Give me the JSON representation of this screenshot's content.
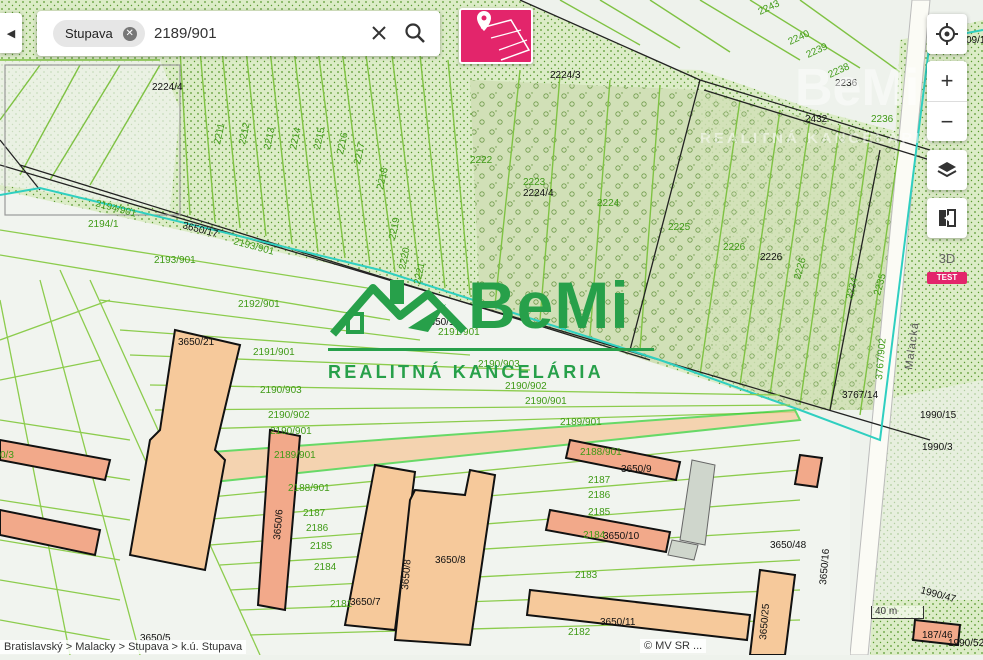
{
  "search": {
    "chip_label": "Stupava",
    "query": "2189/901",
    "placeholder": ""
  },
  "watermark": {
    "brand": "BeMi",
    "subtitle": "REALITNÁ KANCELÁRIA"
  },
  "controls": {
    "zoom_in": "+",
    "zoom_out": "−",
    "three_d": "3D",
    "test_badge": "TEST"
  },
  "map": {
    "street": "Malacká",
    "scale": "40 m",
    "attribution": "© MV SR ...",
    "breadcrumb": "Bratislavský > Malacky > Stupava > k.ú. Stupava",
    "parcels": [
      "2224/4",
      "2211",
      "2212",
      "2213",
      "2214",
      "2215",
      "2216",
      "2217",
      "2218",
      "2219",
      "2220",
      "2221",
      "2224/3",
      "2222",
      "2223",
      "2224/4",
      "2224",
      "2225",
      "2226",
      "2226",
      "2243",
      "2240",
      "2239",
      "2238",
      "2237",
      "2236",
      "2236",
      "2235",
      "2234",
      "2233",
      "2194/901",
      "2194/1",
      "3650/17",
      "2193/901",
      "2192/901",
      "3650/1",
      "2191/901",
      "2191/901",
      "2190/903",
      "2190/903",
      "2190/902",
      "2190/901",
      "2190/902",
      "2190/901",
      "2189/901",
      "2189/901",
      "2188/901",
      "2188/901",
      "2187",
      "2186",
      "2185",
      "2184",
      "2183",
      "2182",
      "2181",
      "2187",
      "2186",
      "2185",
      "2184",
      "3767/14",
      "3767/902",
      "1990/15",
      "1990/3",
      "1990/47",
      "187/46",
      "3650/48",
      "3650/16",
      "3650/25",
      "3650/11",
      "3650/10",
      "3650/9",
      "3650/8",
      "3650/7",
      "3650/6",
      "3650/5",
      "3650/21",
      "3650/4",
      "3650/3",
      "3650/2",
      "09/1",
      "1990/52"
    ],
    "building_labels": [
      "3650/21",
      "3650/6",
      "3650/9",
      "3650/10",
      "3650/8",
      "3650/8",
      "3650/7",
      "3650/11",
      "3650/25",
      "3650/48",
      "3650/16",
      "3650/5",
      "3767/14",
      "1990/15",
      "1990/3",
      "1990/47",
      "187/46"
    ]
  },
  "colors": {
    "accent": "#e3256b",
    "brand_green": "#27a04a",
    "parcel_line": "#7fc243",
    "selected": "#39d13a",
    "boundary": "#2fcfc0",
    "building": "#f6c99b"
  }
}
